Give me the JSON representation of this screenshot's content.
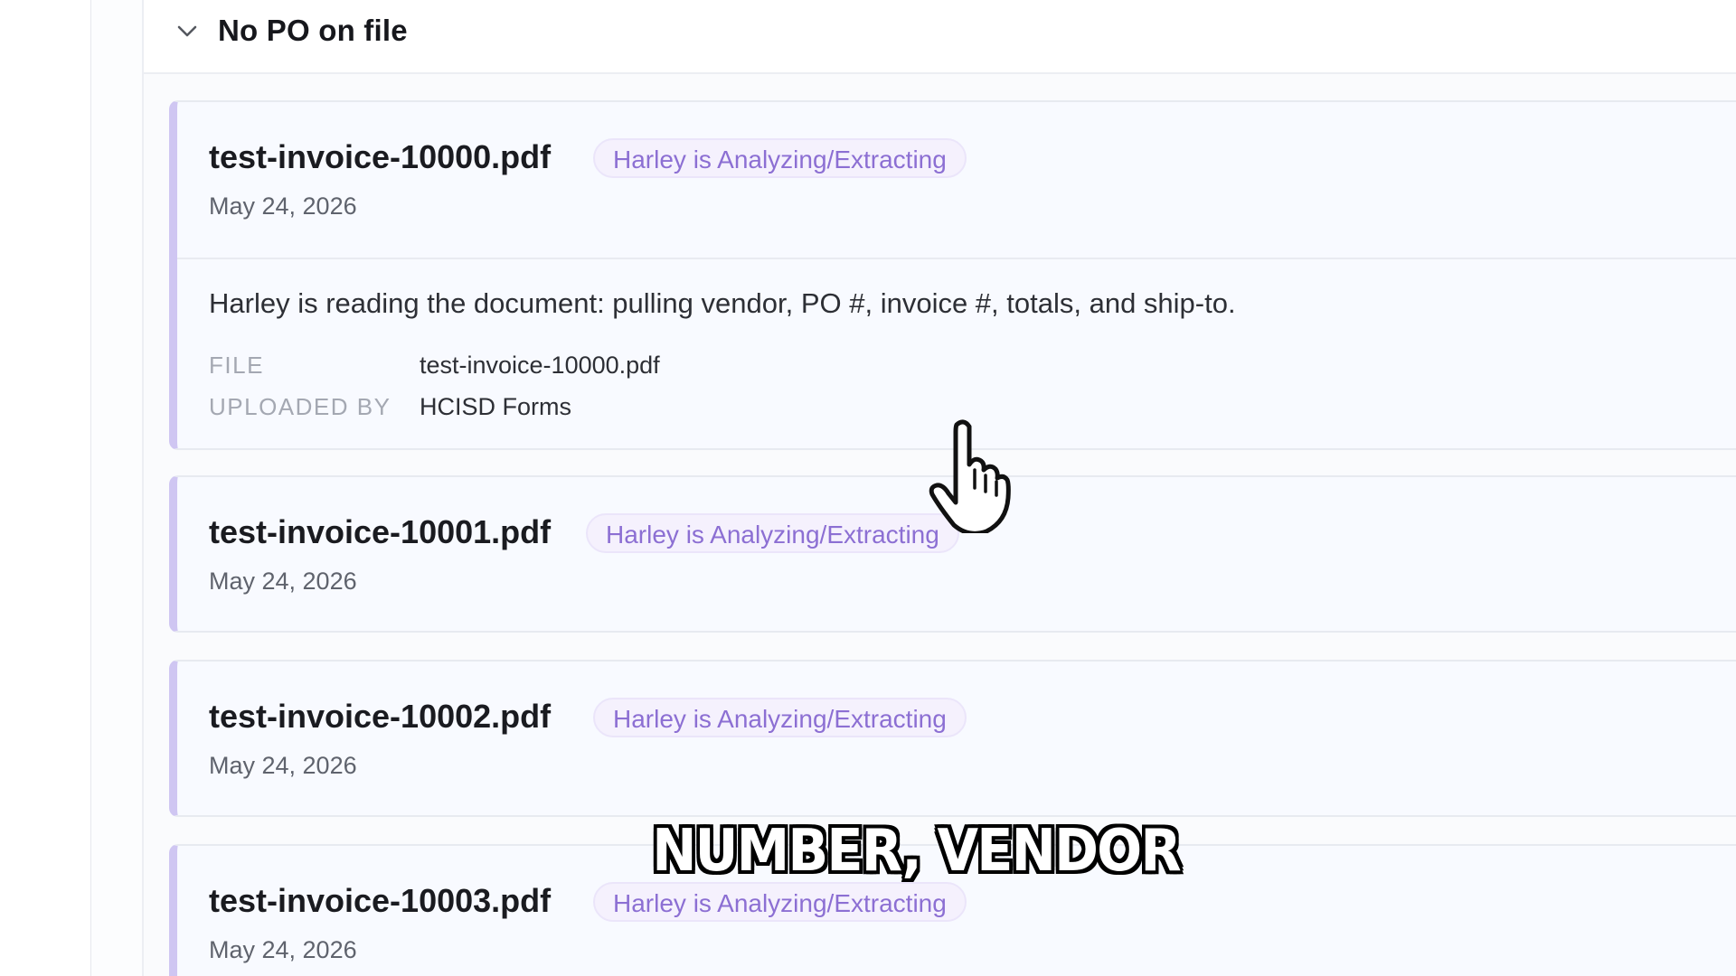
{
  "section": {
    "title": "No PO on file",
    "chevron_icon": "chevron-down-icon"
  },
  "cards": [
    {
      "filename": "test-invoice-10000.pdf",
      "status": "Harley is Analyzing/Extracting",
      "date": "May 24, 2026",
      "expanded": true,
      "description": "Harley is reading the document: pulling vendor, PO #, invoice #, totals, and ship-to.",
      "details": [
        {
          "label": "FILE",
          "value": "test-invoice-10000.pdf"
        },
        {
          "label": "UPLOADED BY",
          "value": "HCISD Forms"
        }
      ]
    },
    {
      "filename": "test-invoice-10001.pdf",
      "status": "Harley is Analyzing/Extracting",
      "date": "May 24, 2026",
      "expanded": false
    },
    {
      "filename": "test-invoice-10002.pdf",
      "status": "Harley is Analyzing/Extracting",
      "date": "May 24, 2026",
      "expanded": false
    },
    {
      "filename": "test-invoice-10003.pdf",
      "status": "Harley is Analyzing/Extracting",
      "date": "May 24, 2026",
      "expanded": false
    }
  ],
  "caption": "NUMBER, VENDOR",
  "colors": {
    "accent_bar": "#cfc6f2",
    "badge_text": "#8c6fd3",
    "badge_bg": "#f5f1fd"
  },
  "cursor_icon": "hand-pointer-icon"
}
